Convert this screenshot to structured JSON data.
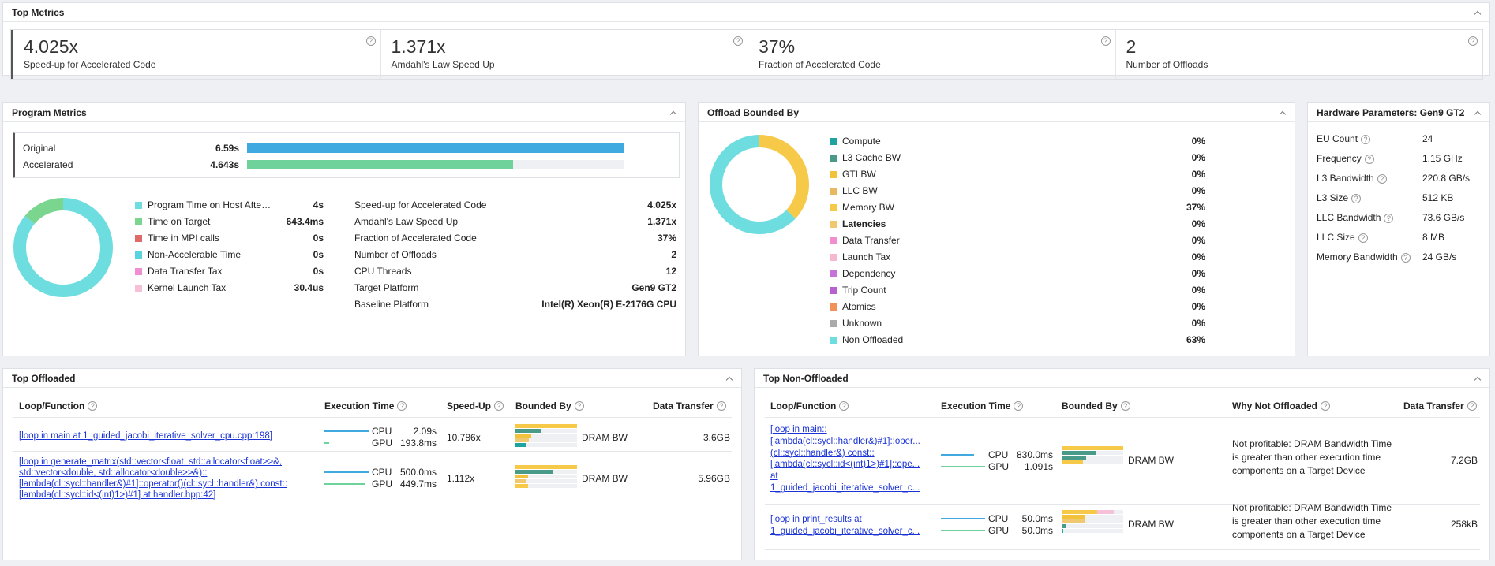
{
  "top_metrics": {
    "title": "Top Metrics",
    "cards": [
      {
        "value": "4.025x",
        "label": "Speed-up for Accelerated Code"
      },
      {
        "value": "1.371x",
        "label": "Amdahl's Law Speed Up"
      },
      {
        "value": "37%",
        "label": "Fraction of Accelerated Code"
      },
      {
        "value": "2",
        "label": "Number of Offloads"
      }
    ]
  },
  "program_metrics": {
    "title": "Program Metrics",
    "bars": [
      {
        "name": "Original",
        "value": "6.59s",
        "fraction": 1.0,
        "color": "#3fa9e0"
      },
      {
        "name": "Accelerated",
        "value": "4.643s",
        "fraction": 0.705,
        "color": "#6fd29a"
      }
    ],
    "legend": [
      {
        "name": "Program Time on Host After A...",
        "value": "4s",
        "color": "#6ddde0"
      },
      {
        "name": "Time on Target",
        "value": "643.4ms",
        "color": "#7ad58f"
      },
      {
        "name": "Time in MPI calls",
        "value": "0s",
        "color": "#e06a6a"
      },
      {
        "name": "Non-Accelerable Time",
        "value": "0s",
        "color": "#5ad3e0"
      },
      {
        "name": "Data Transfer Tax",
        "value": "0s",
        "color": "#f08ed0"
      },
      {
        "name": "Kernel Launch Tax",
        "value": "30.4us",
        "color": "#f6c0d8"
      }
    ],
    "stats": [
      {
        "k": "Speed-up for Accelerated Code",
        "v": "4.025x"
      },
      {
        "k": "Amdahl's Law Speed Up",
        "v": "1.371x"
      },
      {
        "k": "Fraction of Accelerated Code",
        "v": "37%"
      },
      {
        "k": "Number of Offloads",
        "v": "2"
      },
      {
        "k": "CPU Threads",
        "v": "12"
      },
      {
        "k": "Target Platform",
        "v": "Gen9 GT2"
      },
      {
        "k": "Baseline Platform",
        "v": "Intel(R) Xeon(R) E-2176G CPU"
      }
    ],
    "donut": [
      0.86,
      0.14
    ]
  },
  "offload_bounded": {
    "title": "Offload Bounded By",
    "items": [
      {
        "name": "Compute",
        "value": "0%",
        "color": "#1fa3a0",
        "bold": false
      },
      {
        "name": "L3 Cache BW",
        "value": "0%",
        "color": "#4a9a8a",
        "bold": false
      },
      {
        "name": "GTI BW",
        "value": "0%",
        "color": "#f2c23a",
        "bold": false
      },
      {
        "name": "LLC BW",
        "value": "0%",
        "color": "#e8b860",
        "bold": false
      },
      {
        "name": "Memory BW",
        "value": "37%",
        "color": "#f7c948",
        "bold": false
      },
      {
        "name": "Latencies",
        "value": "0%",
        "color": "#f0c870",
        "bold": true
      },
      {
        "name": "Data Transfer",
        "value": "0%",
        "color": "#f08ed0",
        "bold": false
      },
      {
        "name": "Launch Tax",
        "value": "0%",
        "color": "#f6b8d0",
        "bold": false
      },
      {
        "name": "Dependency",
        "value": "0%",
        "color": "#c672d9",
        "bold": false
      },
      {
        "name": "Trip Count",
        "value": "0%",
        "color": "#b860d0",
        "bold": false
      },
      {
        "name": "Atomics",
        "value": "0%",
        "color": "#f0925a",
        "bold": false
      },
      {
        "name": "Unknown",
        "value": "0%",
        "color": "#aaaaaa",
        "bold": false
      },
      {
        "name": "Non Offloaded",
        "value": "63%",
        "color": "#6ddde0",
        "bold": false
      }
    ],
    "donut": [
      0.37,
      0.63
    ]
  },
  "hardware": {
    "title": "Hardware Parameters: Gen9 GT2",
    "items": [
      {
        "k": "EU Count",
        "v": "24"
      },
      {
        "k": "Frequency",
        "v": "1.15 GHz"
      },
      {
        "k": "L3 Bandwidth",
        "v": "220.8 GB/s"
      },
      {
        "k": "L3 Size",
        "v": "512 KB"
      },
      {
        "k": "LLC Bandwidth",
        "v": "73.6 GB/s"
      },
      {
        "k": "LLC Size",
        "v": "8 MB"
      },
      {
        "k": "Memory Bandwidth",
        "v": "24 GB/s"
      }
    ]
  },
  "top_offloaded": {
    "title": "Top Offloaded",
    "columns": [
      "Loop/Function",
      "Execution Time",
      "Speed-Up",
      "Bounded By",
      "Data Transfer"
    ],
    "rows": [
      {
        "fn": [
          "[loop in main at 1_guided_jacobi_iterative_solver_cpu.cpp:198]"
        ],
        "cpu": "2.09s",
        "gpu": "193.8ms",
        "speedup": "10.786x",
        "bounded": "DRAM BW",
        "transfer": "3.6GB"
      },
      {
        "fn": [
          "[loop in generate_matrix(std::vector<float, std::allocator<float>>&,",
          "std::vector<double, std::allocator<double>>&)::",
          "[lambda(cl::sycl::handler&)#1]::operator()(cl::sycl::handler&) const::",
          "[lambda(cl::sycl::id<(int)1>)#1] at handler.hpp:42]"
        ],
        "cpu": "500.0ms",
        "gpu": "449.7ms",
        "speedup": "1.112x",
        "bounded": "DRAM BW",
        "transfer": "5.96GB"
      }
    ],
    "labels": {
      "cpu": "CPU",
      "gpu": "GPU"
    }
  },
  "top_non_offloaded": {
    "title": "Top Non-Offloaded",
    "columns": [
      "Loop/Function",
      "Execution Time",
      "Bounded By",
      "Why Not Offloaded",
      "Data Transfer"
    ],
    "rows": [
      {
        "fn": [
          "[loop in main::",
          "[lambda(cl::sycl::handler&)#1]::oper...",
          "(cl::sycl::handler&) const::",
          "[lambda(cl::sycl::id<(int)1>)#1]::ope...",
          "at",
          "1_guided_jacobi_iterative_solver_c..."
        ],
        "cpu": "830.0ms",
        "gpu": "1.091s",
        "bounded": "DRAM BW",
        "why": [
          "Not profitable: DRAM Bandwidth Time",
          "is greater than other execution time",
          "components on a Target Device"
        ],
        "transfer": "7.2GB"
      },
      {
        "fn": [
          "[loop in print_results at",
          "1_guided_jacobi_iterative_solver_c..."
        ],
        "cpu": "50.0ms",
        "gpu": "50.0ms",
        "bounded": "DRAM BW",
        "why": [
          "Not profitable: DRAM Bandwidth Time",
          "is greater than other execution time",
          "components on a Target Device"
        ],
        "transfer": "258kB"
      }
    ]
  }
}
